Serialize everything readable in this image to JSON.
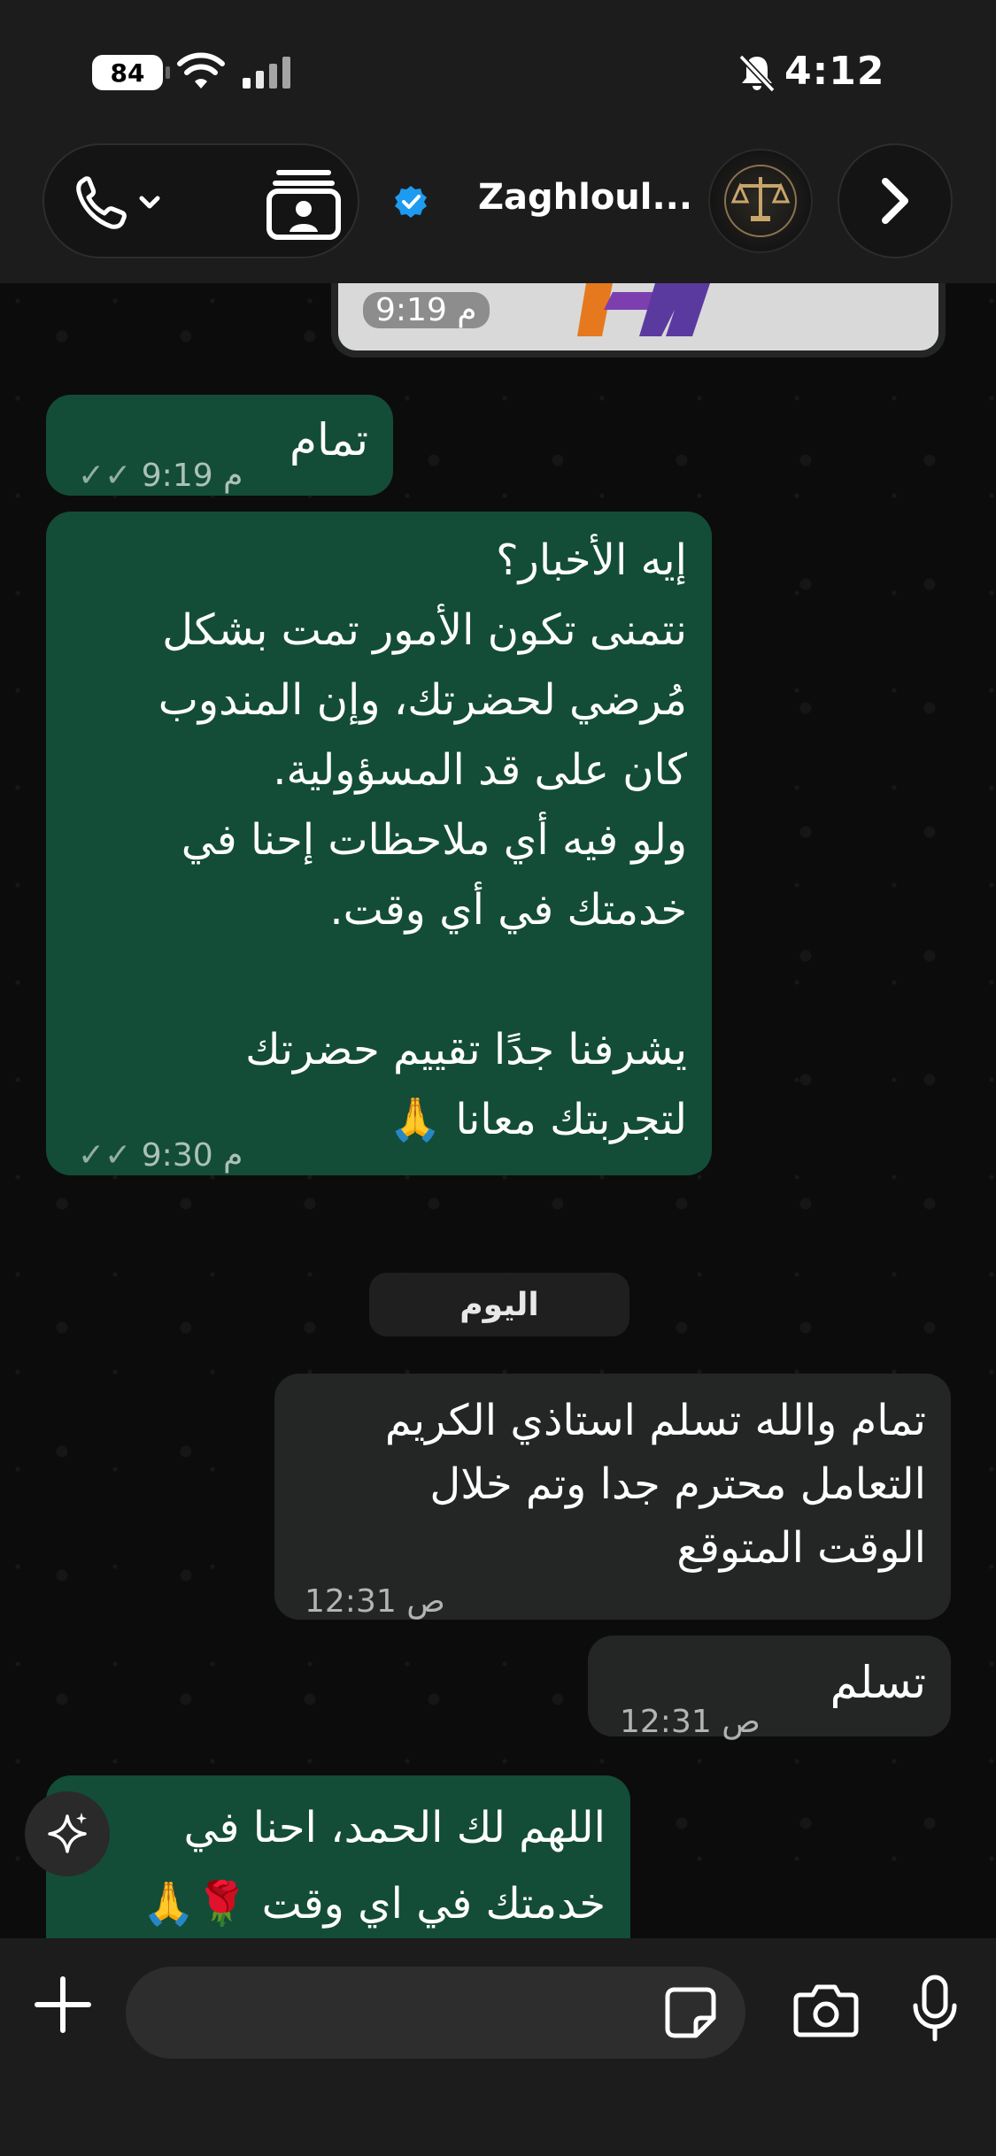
{
  "status_bar": {
    "battery": "84",
    "time": "4:12"
  },
  "header": {
    "contact_name": "Zaghloul...",
    "avatar_alt": "Zaghloul logo"
  },
  "messages": {
    "image_time": "9:19 م",
    "m1": {
      "text": "تمام",
      "time": "9:19 م"
    },
    "m2": {
      "lines": [
        "إيه الأخبار؟",
        "نتمنى تكون الأمور تمت بشكل",
        "مُرضي لحضرتك، وإن المندوب",
        "كان على قد المسؤولية.",
        "ولو فيه أي ملاحظات إحنا في",
        "خدمتك في أي وقت.",
        "",
        "يشرفنا جدًا تقييم حضرتك",
        "لتجربتك معانا 🙏"
      ],
      "time": "9:30 م"
    },
    "date_chip": "اليوم",
    "m3": {
      "lines": [
        "تمام والله تسلم استاذي الكريم",
        "التعامل محترم جدا وتم خلال",
        "الوقت المتوقع"
      ],
      "time": "12:31 ص"
    },
    "m4": {
      "text": "تسلم",
      "time": "12:31 ص"
    },
    "m5": {
      "lines": [
        "اللهم لك الحمد، احنا في",
        "خدمتك في اي وقت 🌹🙏"
      ]
    }
  },
  "input": {
    "placeholder": ""
  },
  "icons": {
    "battery": "battery-icon",
    "wifi": "wifi-icon",
    "cell": "cellular-icon",
    "mute": "bell-slash-icon",
    "phone": "phone-icon",
    "contact": "contact-card-icon",
    "verified": "verified-badge-icon",
    "next": "chevron-right-icon",
    "plus": "plus-icon",
    "sticker": "sticker-icon",
    "camera": "camera-icon",
    "mic": "microphone-icon",
    "ai": "sparkle-icon",
    "ticks": "double-check-icon"
  },
  "colors": {
    "outgoing_bubble": "#134d37",
    "incoming_bubble": "#242626",
    "verified": "#1d9bf0"
  }
}
